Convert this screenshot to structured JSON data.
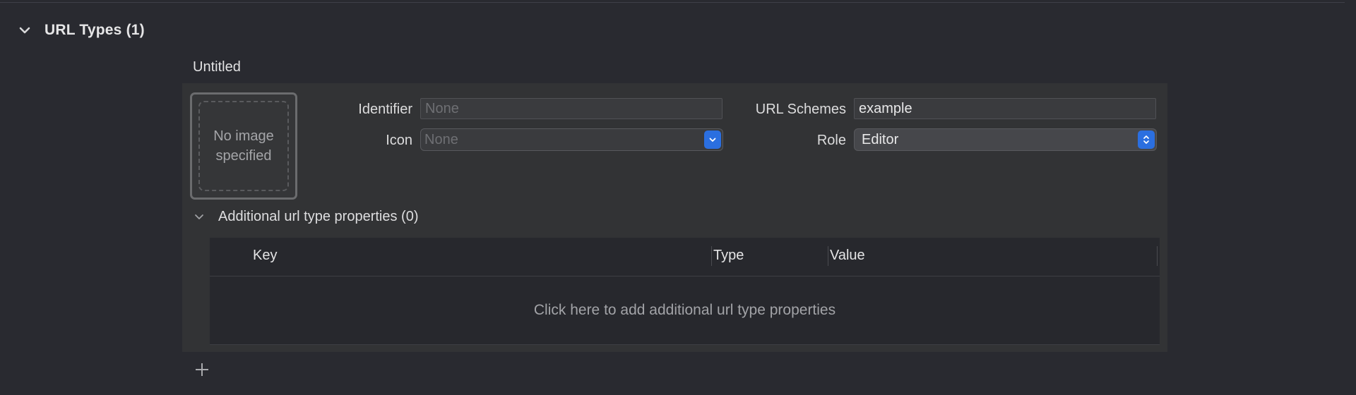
{
  "section": {
    "title": "URL Types (1)",
    "chevron_icon": "chevron-down-icon"
  },
  "url_type": {
    "name": "Untitled",
    "image_well": {
      "text": "No image specified"
    },
    "identifier": {
      "label": "Identifier",
      "value": "",
      "placeholder": "None"
    },
    "icon": {
      "label": "Icon",
      "value": "None",
      "icon": "chevron-down-icon"
    },
    "url_schemes": {
      "label": "URL Schemes",
      "value": "example"
    },
    "role": {
      "label": "Role",
      "value": "Editor",
      "icon": "up-down-chevron-icon"
    }
  },
  "additional_properties": {
    "title": "Additional url type properties (0)",
    "columns": [
      "Key",
      "Type",
      "Value"
    ],
    "empty_text": "Click here to add additional url type properties"
  },
  "toolbar": {
    "add_icon": "plus-icon"
  },
  "colors": {
    "background": "#292a30",
    "panel": "#323335",
    "table": "#27282d",
    "accent": "#2b6fe0",
    "text": "#dfdfe0",
    "muted_text": "#a2a3a7"
  }
}
